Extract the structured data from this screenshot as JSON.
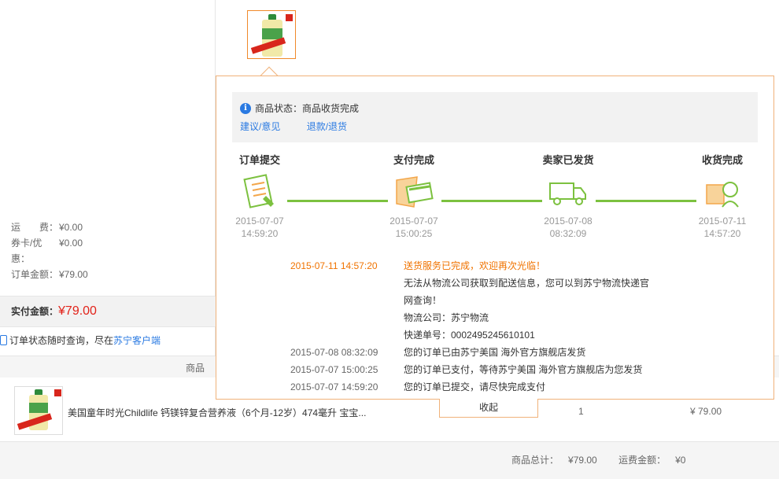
{
  "left_panel": {
    "fees": [
      {
        "label": "运　　费：",
        "value": "¥0.00"
      },
      {
        "label": "券卡/优惠：",
        "value": "¥0.00"
      },
      {
        "label": "订单金额：",
        "value": "¥79.00"
      }
    ],
    "paid_label": "实付金额：",
    "paid_value": "¥79.00",
    "tip_text": "订单状态随时查询，尽在",
    "tip_link": "苏宁客户端"
  },
  "table": {
    "header_product": "商品",
    "product_name": "美国童年时光Childlife 钙镁锌复合营养液（6个月-12岁）474毫升 宝宝...",
    "quantity": "1",
    "price": "¥ 79.00"
  },
  "summary": {
    "goods_total_label": "商品总计：",
    "goods_total_value": "¥79.00",
    "shipping_label": "运费金额：",
    "shipping_value": "¥0"
  },
  "panel": {
    "status_label": "商品状态：",
    "status_value": "商品收货完成",
    "link_feedback": "建议/意见",
    "link_refund": "退款/退货",
    "steps": [
      {
        "title": "订单提交",
        "date": "2015-07-07",
        "time": "14:59:20"
      },
      {
        "title": "支付完成",
        "date": "2015-07-07",
        "time": "15:00:25"
      },
      {
        "title": "卖家已发货",
        "date": "2015-07-08",
        "time": "08:32:09"
      },
      {
        "title": "收货完成",
        "date": "2015-07-11",
        "time": "14:57:20"
      }
    ],
    "log": [
      {
        "time": "2015-07-11 14:57:20",
        "msg": "送货服务已完成，欢迎再次光临！"
      },
      {
        "time": "",
        "msg": "无法从物流公司获取到配送信息，您可以到苏宁物流快递官"
      },
      {
        "time": "",
        "msg": "网查询！"
      },
      {
        "time": "",
        "msg": "物流公司：苏宁物流"
      },
      {
        "time": "",
        "msg": "快递单号：0002495245610101"
      },
      {
        "time": "2015-07-08 08:32:09",
        "msg": "您的订单已由苏宁美国 海外官方旗舰店发货"
      },
      {
        "time": "2015-07-07 15:00:25",
        "msg": "您的订单已支付，等待苏宁美国 海外官方旗舰店为您发货"
      },
      {
        "time": "2015-07-07 14:59:20",
        "msg": "您的订单已提交，请尽快完成支付"
      }
    ],
    "collapse_label": "收起"
  },
  "colors": {
    "accent_orange": "#f07300",
    "link_blue": "#2a7ae2",
    "price_red": "#e2231a",
    "progress_green": "#7cc13f"
  }
}
